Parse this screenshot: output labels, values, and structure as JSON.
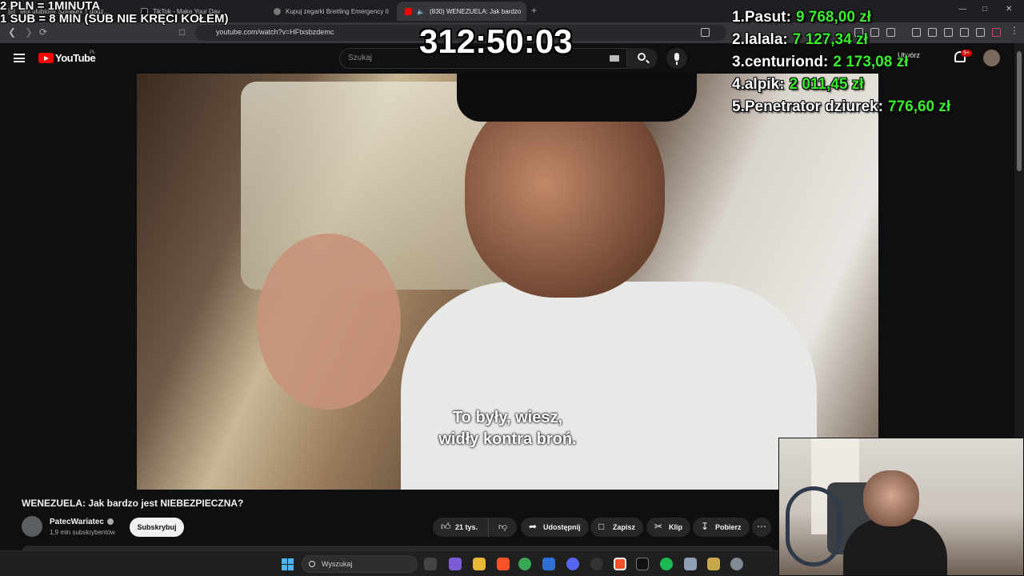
{
  "browser": {
    "tabs": [
      {
        "title": "Mój ulubiony Szmatex 1 godz...",
        "active": false
      },
      {
        "title": "TikTok - Make Your Day",
        "active": false
      },
      {
        "title": "Kupuj zegarki Breitling Emergency II",
        "active": false
      },
      {
        "title": "(830) WENEZUELA: Jak bardzo",
        "active": true
      }
    ],
    "url": "youtube.com/watch?v=HFtxsbzdemc"
  },
  "youtube": {
    "logo_text": "YouTube",
    "logo_region": "PL",
    "search_placeholder": "Szukaj",
    "create_label": "Utwórz",
    "notification_count": "9+",
    "subtitle_line1": "To były, wiesz,",
    "subtitle_line2": "widły kontra broń.",
    "video_title": "WENEZUELA: Jak bardzo jest NIEBEZPIECZNA?",
    "channel_name": "PatecWariatec",
    "channel_subs": "1,9 mln subskrybentów",
    "subscribe_label": "Subskrybuj",
    "like_count": "21 tys.",
    "share_label": "Udostępnij",
    "save_label": "Zapisz",
    "clip_label": "Klip",
    "download_label": "Pobierz"
  },
  "overlay": {
    "rate_line1": "2 PLN =  1MINUTA",
    "rate_line2": "1 SUB = 8 MIN (SUB NIE KRĘCI KOŁEM)",
    "timer": "312:50:03",
    "leaderboard": [
      {
        "rank": "1.",
        "name": "Pasut:",
        "amount": "9 768,00 zł"
      },
      {
        "rank": "2.",
        "name": "lalala:",
        "amount": "7 127,34 zł"
      },
      {
        "rank": "3.",
        "name": "centuriond:",
        "amount": "2 173,08 zł"
      },
      {
        "rank": "4.",
        "name": "alpik:",
        "amount": "2 011,45 zł"
      },
      {
        "rank": "5.",
        "name": "Penetrator dziurek:",
        "amount": "776,60 zł"
      }
    ],
    "amount_color": "#39f12b"
  },
  "taskbar": {
    "search_placeholder": "Wyszukaj"
  },
  "colors": {
    "youtube_red": "#ff0000",
    "background": "#0f0f0f"
  }
}
